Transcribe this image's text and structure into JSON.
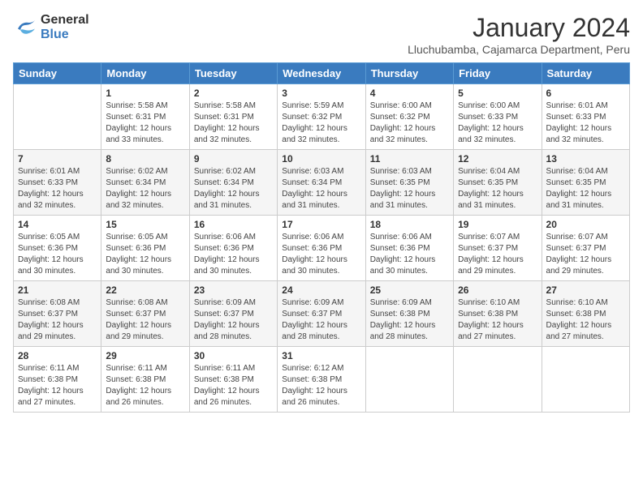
{
  "logo": {
    "line1": "General",
    "line2": "Blue"
  },
  "title": "January 2024",
  "location": "Lluchubamba, Cajamarca Department, Peru",
  "days_of_week": [
    "Sunday",
    "Monday",
    "Tuesday",
    "Wednesday",
    "Thursday",
    "Friday",
    "Saturday"
  ],
  "weeks": [
    [
      {
        "day": "",
        "content": ""
      },
      {
        "day": "1",
        "content": "Sunrise: 5:58 AM\nSunset: 6:31 PM\nDaylight: 12 hours\nand 33 minutes."
      },
      {
        "day": "2",
        "content": "Sunrise: 5:58 AM\nSunset: 6:31 PM\nDaylight: 12 hours\nand 32 minutes."
      },
      {
        "day": "3",
        "content": "Sunrise: 5:59 AM\nSunset: 6:32 PM\nDaylight: 12 hours\nand 32 minutes."
      },
      {
        "day": "4",
        "content": "Sunrise: 6:00 AM\nSunset: 6:32 PM\nDaylight: 12 hours\nand 32 minutes."
      },
      {
        "day": "5",
        "content": "Sunrise: 6:00 AM\nSunset: 6:33 PM\nDaylight: 12 hours\nand 32 minutes."
      },
      {
        "day": "6",
        "content": "Sunrise: 6:01 AM\nSunset: 6:33 PM\nDaylight: 12 hours\nand 32 minutes."
      }
    ],
    [
      {
        "day": "7",
        "content": "Sunrise: 6:01 AM\nSunset: 6:33 PM\nDaylight: 12 hours\nand 32 minutes."
      },
      {
        "day": "8",
        "content": "Sunrise: 6:02 AM\nSunset: 6:34 PM\nDaylight: 12 hours\nand 32 minutes."
      },
      {
        "day": "9",
        "content": "Sunrise: 6:02 AM\nSunset: 6:34 PM\nDaylight: 12 hours\nand 31 minutes."
      },
      {
        "day": "10",
        "content": "Sunrise: 6:03 AM\nSunset: 6:34 PM\nDaylight: 12 hours\nand 31 minutes."
      },
      {
        "day": "11",
        "content": "Sunrise: 6:03 AM\nSunset: 6:35 PM\nDaylight: 12 hours\nand 31 minutes."
      },
      {
        "day": "12",
        "content": "Sunrise: 6:04 AM\nSunset: 6:35 PM\nDaylight: 12 hours\nand 31 minutes."
      },
      {
        "day": "13",
        "content": "Sunrise: 6:04 AM\nSunset: 6:35 PM\nDaylight: 12 hours\nand 31 minutes."
      }
    ],
    [
      {
        "day": "14",
        "content": "Sunrise: 6:05 AM\nSunset: 6:36 PM\nDaylight: 12 hours\nand 30 minutes."
      },
      {
        "day": "15",
        "content": "Sunrise: 6:05 AM\nSunset: 6:36 PM\nDaylight: 12 hours\nand 30 minutes."
      },
      {
        "day": "16",
        "content": "Sunrise: 6:06 AM\nSunset: 6:36 PM\nDaylight: 12 hours\nand 30 minutes."
      },
      {
        "day": "17",
        "content": "Sunrise: 6:06 AM\nSunset: 6:36 PM\nDaylight: 12 hours\nand 30 minutes."
      },
      {
        "day": "18",
        "content": "Sunrise: 6:06 AM\nSunset: 6:36 PM\nDaylight: 12 hours\nand 30 minutes."
      },
      {
        "day": "19",
        "content": "Sunrise: 6:07 AM\nSunset: 6:37 PM\nDaylight: 12 hours\nand 29 minutes."
      },
      {
        "day": "20",
        "content": "Sunrise: 6:07 AM\nSunset: 6:37 PM\nDaylight: 12 hours\nand 29 minutes."
      }
    ],
    [
      {
        "day": "21",
        "content": "Sunrise: 6:08 AM\nSunset: 6:37 PM\nDaylight: 12 hours\nand 29 minutes."
      },
      {
        "day": "22",
        "content": "Sunrise: 6:08 AM\nSunset: 6:37 PM\nDaylight: 12 hours\nand 29 minutes."
      },
      {
        "day": "23",
        "content": "Sunrise: 6:09 AM\nSunset: 6:37 PM\nDaylight: 12 hours\nand 28 minutes."
      },
      {
        "day": "24",
        "content": "Sunrise: 6:09 AM\nSunset: 6:37 PM\nDaylight: 12 hours\nand 28 minutes."
      },
      {
        "day": "25",
        "content": "Sunrise: 6:09 AM\nSunset: 6:38 PM\nDaylight: 12 hours\nand 28 minutes."
      },
      {
        "day": "26",
        "content": "Sunrise: 6:10 AM\nSunset: 6:38 PM\nDaylight: 12 hours\nand 27 minutes."
      },
      {
        "day": "27",
        "content": "Sunrise: 6:10 AM\nSunset: 6:38 PM\nDaylight: 12 hours\nand 27 minutes."
      }
    ],
    [
      {
        "day": "28",
        "content": "Sunrise: 6:11 AM\nSunset: 6:38 PM\nDaylight: 12 hours\nand 27 minutes."
      },
      {
        "day": "29",
        "content": "Sunrise: 6:11 AM\nSunset: 6:38 PM\nDaylight: 12 hours\nand 26 minutes."
      },
      {
        "day": "30",
        "content": "Sunrise: 6:11 AM\nSunset: 6:38 PM\nDaylight: 12 hours\nand 26 minutes."
      },
      {
        "day": "31",
        "content": "Sunrise: 6:12 AM\nSunset: 6:38 PM\nDaylight: 12 hours\nand 26 minutes."
      },
      {
        "day": "",
        "content": ""
      },
      {
        "day": "",
        "content": ""
      },
      {
        "day": "",
        "content": ""
      }
    ]
  ]
}
